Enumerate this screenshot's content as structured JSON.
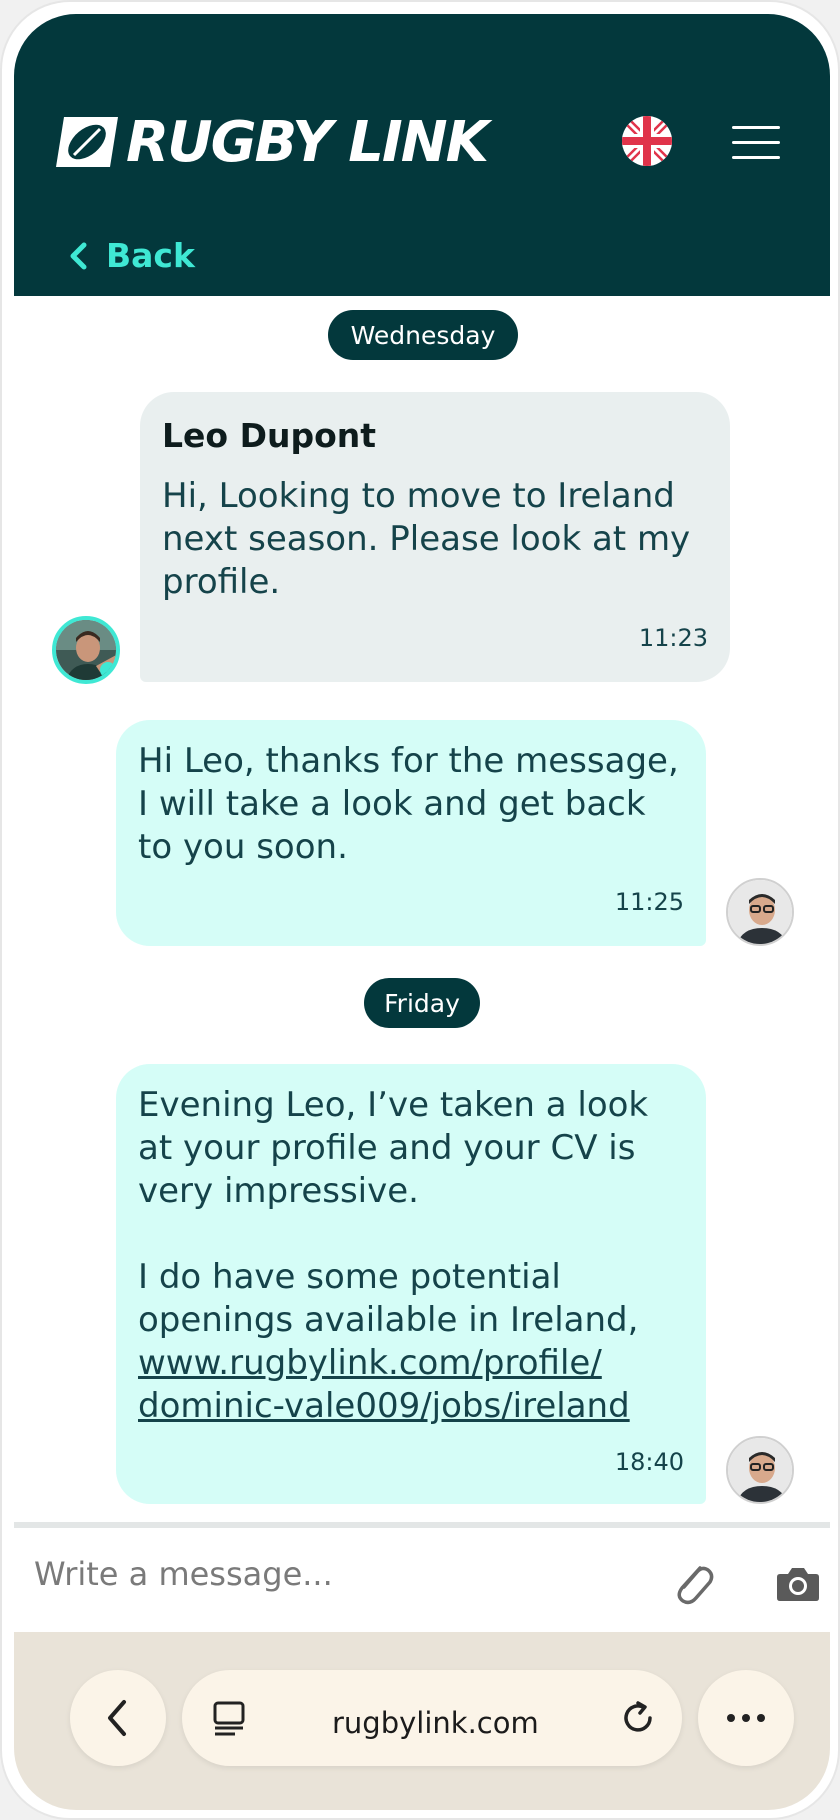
{
  "header": {
    "logo_text": "RUGBY LINK",
    "language_flag": "uk-flag-icon",
    "menu_icon": "hamburger-menu-icon",
    "back_label": "Back"
  },
  "chat": {
    "groups": [
      {
        "day": "Wednesday",
        "messages": [
          {
            "direction": "incoming",
            "sender": "Leo Dupont",
            "text_lines": [
              "Hi, Looking to move to Ireland",
              "next season. Please look at my",
              "profile."
            ],
            "time": "11:23"
          },
          {
            "direction": "outgoing",
            "text_lines": [
              "Hi Leo, thanks for the message,",
              "I will take a look and get back",
              "to you soon."
            ],
            "time": "11:25"
          }
        ]
      },
      {
        "day": "Friday",
        "messages": [
          {
            "direction": "outgoing",
            "text_lines": [
              "Evening Leo, I’ve taken a look",
              "at your profile and your CV is",
              "very impressive.",
              "",
              "I do have some potential",
              "openings available in Ireland,"
            ],
            "link_lines": [
              "www.rugbylink.com/profile/",
              "dominic-vale009/jobs/ireland"
            ],
            "time": "18:40"
          }
        ]
      }
    ]
  },
  "composer": {
    "placeholder": "Write a message...",
    "attach_icon": "paperclip-icon",
    "camera_icon": "camera-icon"
  },
  "browser": {
    "url": "rugbylink.com",
    "back_icon": "chevron-left-icon",
    "tabs_icon": "tabs-icon",
    "reload_icon": "reload-icon",
    "more_icon": "more-dots-icon"
  },
  "colors": {
    "header_bg": "#03383c",
    "accent": "#3fe8d4",
    "incoming_bubble": "#e9efef",
    "outgoing_bubble": "#d5fdf7"
  }
}
